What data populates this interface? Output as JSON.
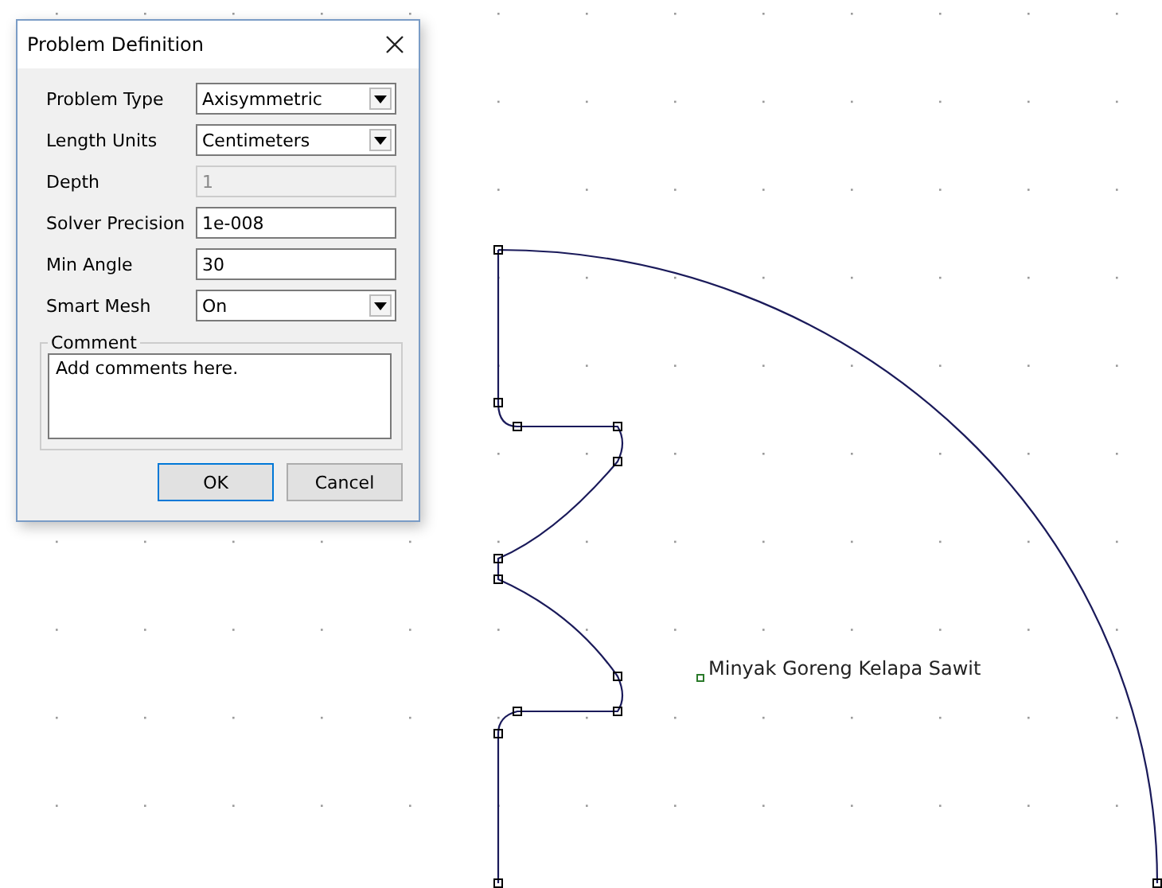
{
  "canvas": {
    "block_label": "Minyak Goreng Kelapa Sawit"
  },
  "dialog": {
    "title": "Problem Definition",
    "fields": [
      {
        "label": "Problem Type",
        "kind": "select",
        "value": "Axisymmetric",
        "disabled": false
      },
      {
        "label": "Length Units",
        "kind": "select",
        "value": "Centimeters",
        "disabled": false
      },
      {
        "label": "Depth",
        "kind": "text",
        "value": "1",
        "disabled": true
      },
      {
        "label": "Solver Precision",
        "kind": "text",
        "value": "1e-008",
        "disabled": false
      },
      {
        "label": "Min Angle",
        "kind": "text",
        "value": "30",
        "disabled": false
      },
      {
        "label": "Smart Mesh",
        "kind": "select",
        "value": "On",
        "disabled": false
      }
    ],
    "comment": {
      "legend": "Comment",
      "value": "Add comments here."
    },
    "buttons": [
      {
        "label": "OK",
        "default": true
      },
      {
        "label": "Cancel",
        "default": false
      }
    ]
  }
}
